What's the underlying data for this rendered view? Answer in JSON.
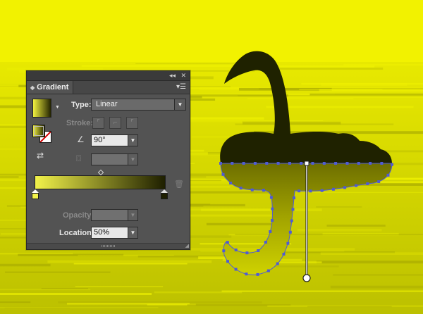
{
  "colors": {
    "sky": "#f2f200",
    "water_top": "#e2e400",
    "water_bottom": "#bdc000",
    "swan": "#1f2200",
    "selection": "#4f5bd5",
    "panel_bg": "#535353",
    "gradient_start": "#f2f24a",
    "gradient_end": "#1e1f00"
  },
  "panel": {
    "title": "Gradient",
    "collapse_icon": "double-chevron-left-icon",
    "close_icon": "close-icon",
    "menu_icon": "panel-menu-icon",
    "type_label": "Type:",
    "type_value": "Linear",
    "stroke_label": "Stroke:",
    "angle_value": "90°",
    "opacity_label": "Opacity:",
    "location_label": "Location:",
    "location_value": "50%"
  },
  "gradient": {
    "type": "linear",
    "angle_deg": 90,
    "stops": [
      {
        "color": "#f2f24a",
        "location_pct": 0
      },
      {
        "color": "#1e1f00",
        "location_pct": 100
      }
    ],
    "midpoint_pct": 50
  }
}
